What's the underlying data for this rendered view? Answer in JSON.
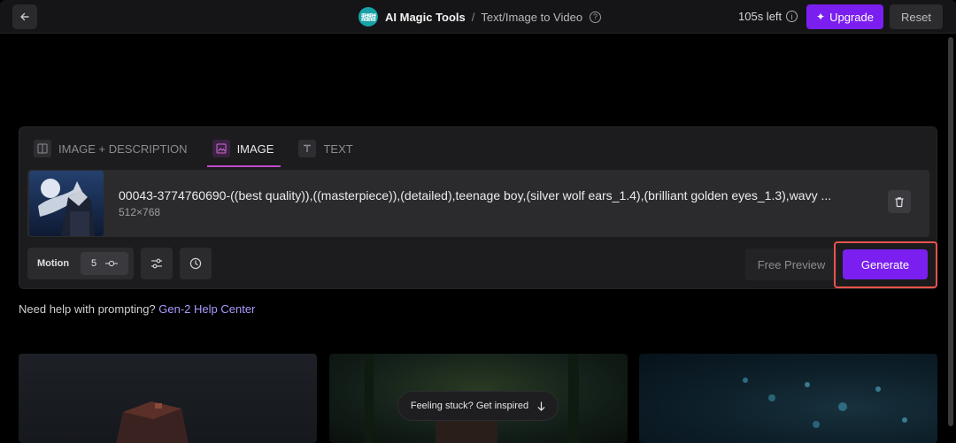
{
  "header": {
    "app_name": "AI Magic Tools",
    "separator": "/",
    "page_name": "Text/Image to Video",
    "time_left": "105s left",
    "upgrade_label": "Upgrade",
    "reset_label": "Reset",
    "accent_color": "#7a1ff0"
  },
  "tabs": [
    {
      "label": "IMAGE + DESCRIPTION",
      "icon": "image-description-icon",
      "active": false
    },
    {
      "label": "IMAGE",
      "icon": "image-icon",
      "active": true
    },
    {
      "label": "TEXT",
      "icon": "text-icon",
      "active": false
    }
  ],
  "file": {
    "name": "00043-3774760690-((best quality)),((masterpiece)),(detailed),teenage boy,(silver wolf ears_1.4),(brilliant golden eyes_1.3),wavy ...",
    "size": "512×768"
  },
  "controls": {
    "motion_label": "Motion",
    "motion_value": "5",
    "free_preview_label": "Free Preview",
    "generate_label": "Generate"
  },
  "help": {
    "text": "Need help with prompting?",
    "link": "Gen-2 Help Center"
  },
  "inspire": {
    "label": "Feeling stuck? Get inspired"
  }
}
